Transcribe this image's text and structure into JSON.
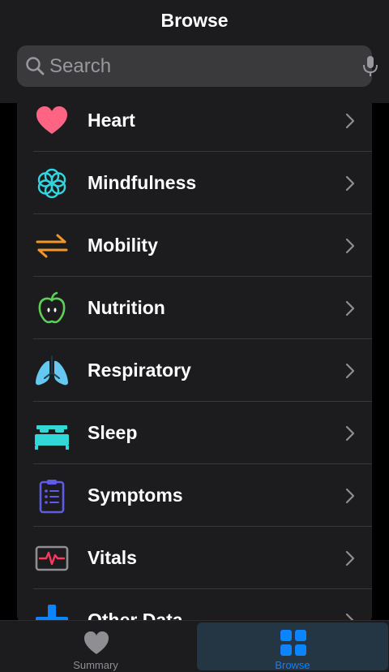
{
  "header": {
    "title": "Browse"
  },
  "search": {
    "placeholder": "Search"
  },
  "categories": [
    {
      "label": "Heart",
      "icon": "heart-icon",
      "color": "#ff6482"
    },
    {
      "label": "Mindfulness",
      "icon": "mindfulness-icon",
      "color": "#30d5e0"
    },
    {
      "label": "Mobility",
      "icon": "mobility-arrows-icon",
      "color": "#f0962c"
    },
    {
      "label": "Nutrition",
      "icon": "apple-icon",
      "color": "#5ed05a"
    },
    {
      "label": "Respiratory",
      "icon": "lungs-icon",
      "color": "#64c8f0"
    },
    {
      "label": "Sleep",
      "icon": "bed-icon",
      "color": "#30d8d8"
    },
    {
      "label": "Symptoms",
      "icon": "clipboard-icon",
      "color": "#5e5ce6"
    },
    {
      "label": "Vitals",
      "icon": "vitals-monitor-icon",
      "color": "#ff375f"
    },
    {
      "label": "Other Data",
      "icon": "plus-icon",
      "color": "#0a84ff"
    }
  ],
  "tabbar": {
    "tabs": [
      {
        "label": "Summary",
        "icon": "heart-icon",
        "selected": false
      },
      {
        "label": "Browse",
        "icon": "grid-icon",
        "selected": true
      }
    ]
  },
  "colors": {
    "accent": "#0a84ff",
    "background": "#000000",
    "surface": "#1c1c1e"
  }
}
